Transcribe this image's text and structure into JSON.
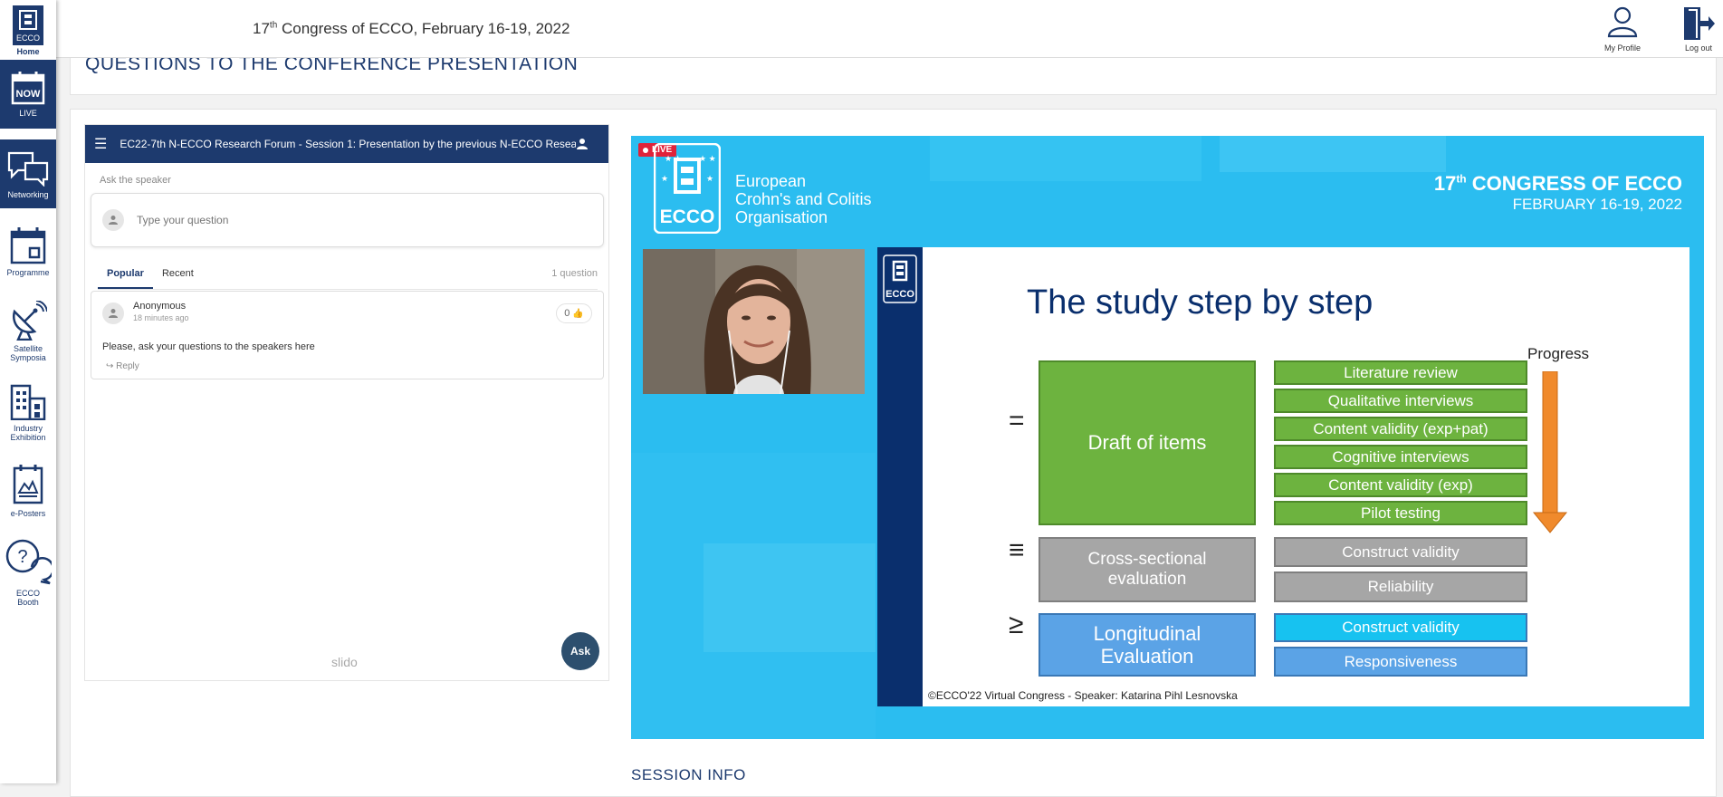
{
  "header": {
    "title_prefix": "17",
    "title_sup": "th",
    "title_rest": " Congress of ECCO, February 16-19, 2022",
    "home_label": "Home",
    "logo_text": "ECCO",
    "profile_label": "My Profile",
    "logout_label": "Log out"
  },
  "sidebar": {
    "items": [
      {
        "label": "LIVE",
        "icon_text": "NOW"
      },
      {
        "label": "Networking"
      },
      {
        "label": "Programme"
      },
      {
        "label": "Satellite Symposia"
      },
      {
        "label": "Industry Exhibition"
      },
      {
        "label": "e-Posters"
      },
      {
        "label": "ECCO Booth"
      }
    ]
  },
  "page": {
    "section_title": "QUESTIONS TO THE CONFERENCE PRESENTATION",
    "session_info": "SESSION INFO"
  },
  "slido": {
    "session_title": "EC22-7th N-ECCO Research Forum - Session 1: Presentation by the previous N-ECCO Resea...",
    "ask_label": "Ask the speaker",
    "question_placeholder": "Type your question",
    "tabs": [
      "Popular",
      "Recent"
    ],
    "question_count": "1 question",
    "question": {
      "author": "Anonymous",
      "time": "18 minutes ago",
      "likes": "0",
      "text": "Please, ask your questions to the speakers here",
      "reply_label": "Reply"
    },
    "brand": "slido",
    "ask_button": "Ask"
  },
  "video": {
    "live_badge": "LIVE",
    "org_line1": "European",
    "org_line2": "Crohn's and Colitis",
    "org_line3": "Organisation",
    "logo_text": "ECCO",
    "congress_num": "17",
    "congress_sup": "th",
    "congress_rest": " CONGRESS OF ECCO",
    "congress_dates": "FEBRUARY 16-19, 2022"
  },
  "slide": {
    "logo_text": "ECCO",
    "title": "The study step by step",
    "progress_label": "Progress",
    "phases": [
      {
        "symbol": "=",
        "label": "Draft of items",
        "steps": [
          "Literature review",
          "Qualitative interviews",
          "Content validity (exp+pat)",
          "Cognitive interviews",
          "Content validity (exp)",
          "Pilot testing"
        ]
      },
      {
        "symbol": "≡",
        "label": "Cross-sectional evaluation",
        "steps": [
          "Construct validity",
          "Reliability"
        ]
      },
      {
        "symbol": "≥",
        "label": "Longitudinal Evaluation",
        "steps": [
          "Construct validity",
          "Responsiveness"
        ]
      }
    ],
    "footer": "©ECCO'22 Virtual Congress -  Speaker: Katarina Pihl Lesnovska"
  },
  "colors": {
    "navy": "#1d3a6e",
    "video_bg": "#2bbdf0",
    "green": "#6db33f",
    "grey": "#a6a6a6",
    "blue": "#5ba3e6",
    "arrow": "#f08a2c",
    "live_red": "#e0223a"
  }
}
